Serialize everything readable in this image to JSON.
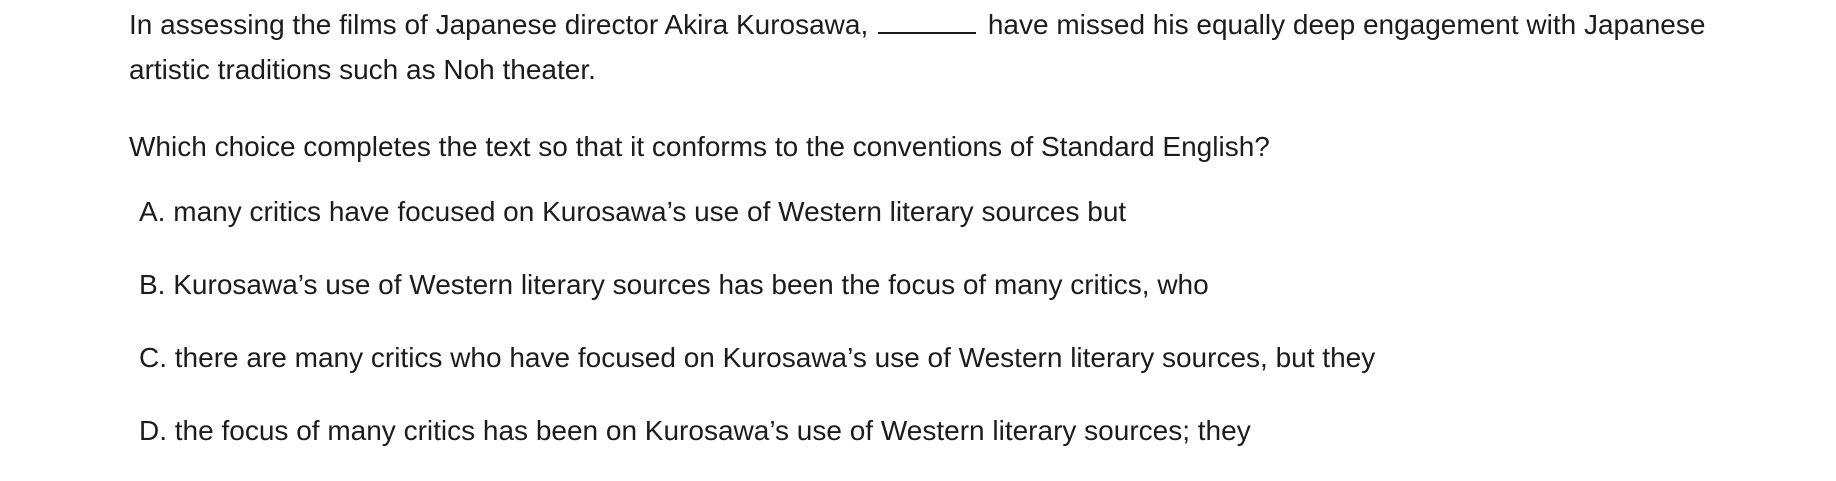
{
  "passage": {
    "before_blank": "In assessing the films of Japanese director Akira Kurosawa,",
    "after_blank": "have missed his equally deep engagement with Japanese artistic traditions such as Noh theater."
  },
  "question": "Which choice completes the text so that it conforms to the conventions of Standard English?",
  "choices": [
    {
      "letter": "A.",
      "text": "many critics have focused on Kurosawa’s use of Western literary sources but"
    },
    {
      "letter": "B.",
      "text": "Kurosawa’s use of Western literary sources has been the focus of many critics, who"
    },
    {
      "letter": "C.",
      "text": "there are many critics who have focused on Kurosawa’s use of Western literary sources, but they"
    },
    {
      "letter": "D.",
      "text": "the focus of many critics has been on Kurosawa’s use of Western literary sources; they"
    }
  ]
}
